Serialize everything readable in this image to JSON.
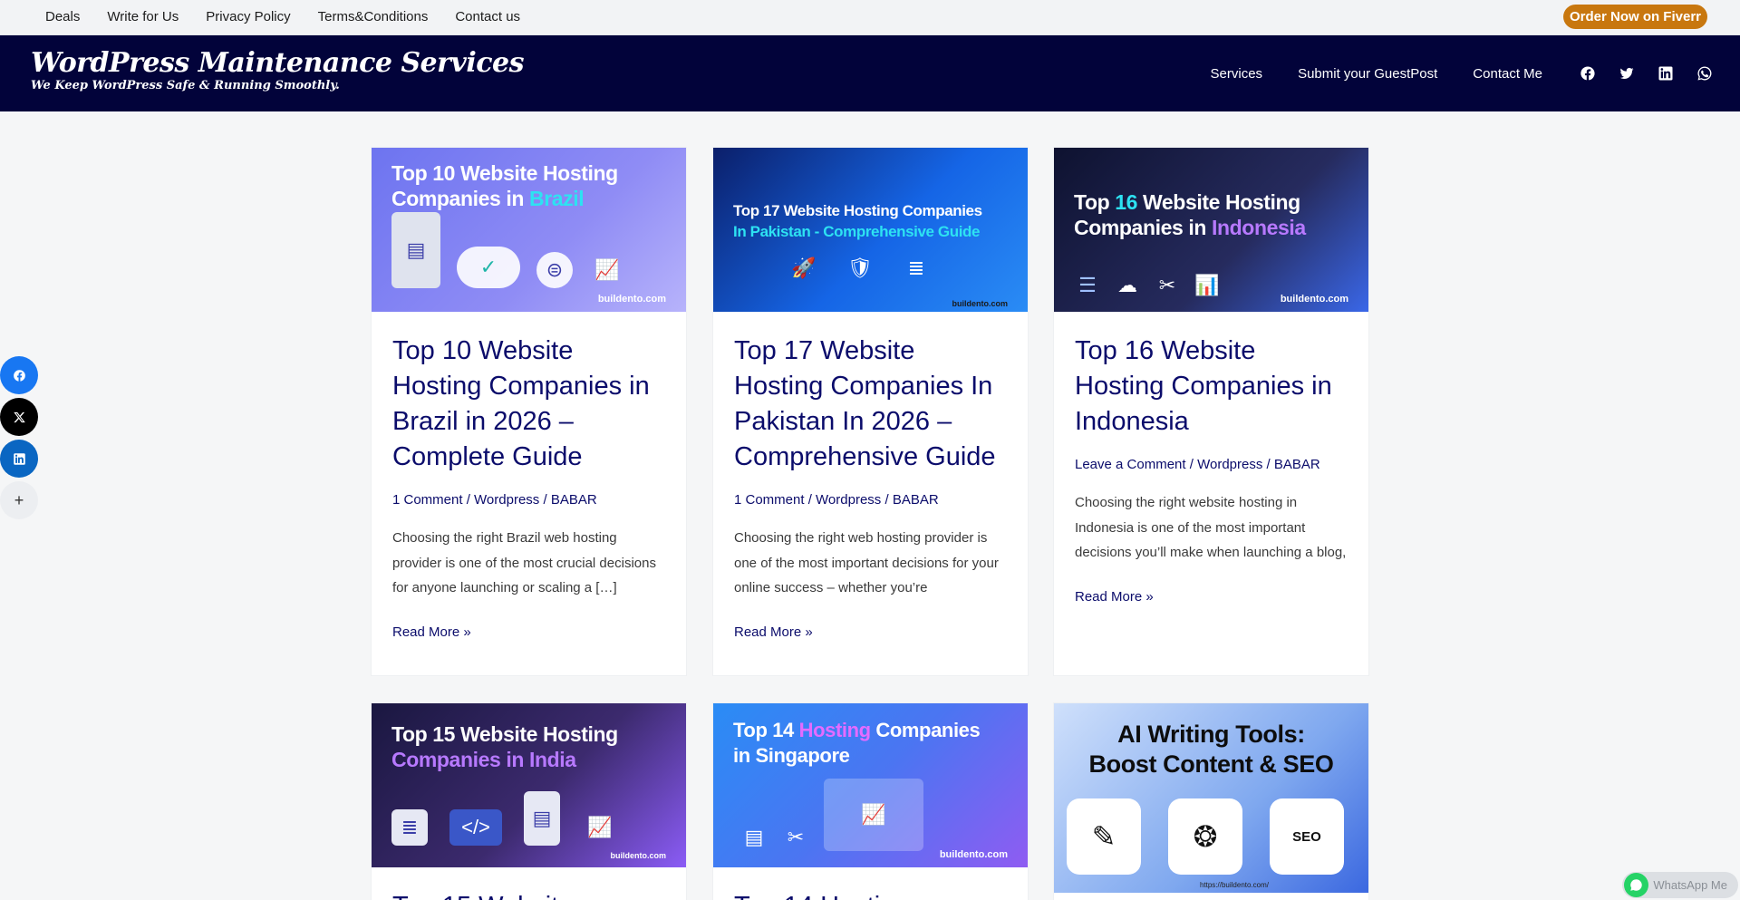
{
  "topbar": {
    "links": [
      "Deals",
      "Write for Us",
      "Privacy Policy",
      "Terms&Conditions",
      "Contact us"
    ],
    "cta": "Order Now on Fiverr"
  },
  "header": {
    "logo_title": "WordPress Maintenance Services",
    "logo_tagline": "We Keep WordPress Safe & Running Smoothly.",
    "nav": [
      "Services",
      "Submit your GuestPost",
      "Contact Me"
    ],
    "social_icons": [
      "facebook-icon",
      "twitter-icon",
      "linkedin-icon",
      "whatsapp-icon"
    ]
  },
  "share_sidebar": {
    "buttons": [
      "facebook-icon",
      "x-icon",
      "linkedin-icon",
      "plus-icon"
    ],
    "more_label": "+"
  },
  "posts": [
    {
      "thumb_line1": "Top 10 Website Hosting",
      "thumb_line2_pre": "Companies in ",
      "thumb_line2_accent": "Brazil",
      "thumb_url": "buildento.com",
      "title": "Top 10 Website Hosting Companies in Brazil in 2026 – Complete Guide",
      "comments": "1 Comment",
      "category": "Wordpress",
      "author": "BABAR",
      "excerpt": "Choosing the right Brazil web hosting provider is one of the most crucial decisions for anyone launching or scaling a […]",
      "read_more": "Read More »"
    },
    {
      "thumb_line1": "Top 17 Website Hosting Companies",
      "thumb_line2_pre": "",
      "thumb_line2_accent": "In Pakistan - Comprehensive Guide",
      "thumb_url": "buildento.com",
      "title": "Top 17 Website Hosting Companies In Pakistan In 2026 – Comprehensive Guide",
      "comments": "1 Comment",
      "category": "Wordpress",
      "author": "BABAR",
      "excerpt": "Choosing the right web hosting provider is one of the most important decisions for your online success – whether you’re",
      "read_more": "Read More »"
    },
    {
      "thumb_line1_pre": "Top ",
      "thumb_line1_accent": "16",
      "thumb_line1_post": " Website Hosting",
      "thumb_line2_pre": "Companies in ",
      "thumb_line2_accent": "Indonesia",
      "thumb_url": "buildento.com",
      "title": "Top 16 Website Hosting Companies in Indonesia",
      "comments": "Leave a Comment",
      "category": "Wordpress",
      "author": "BABAR",
      "excerpt": "Choosing the right website hosting in Indonesia is one of the most important decisions you’ll make when launching a blog,",
      "read_more": "Read More »"
    },
    {
      "thumb_line1": "Top 15 Website Hosting",
      "thumb_line2_accent": "Companies in India",
      "thumb_url": "buildento.com",
      "title_partial": "Top 15 Websit"
    },
    {
      "thumb_line1_pre": "Top 14 ",
      "thumb_line1_accent": "Hosting",
      "thumb_line1_post": " Companies",
      "thumb_line2": "in Singapore",
      "thumb_url": "buildento.com",
      "title_partial": "Top 14 Hosti"
    },
    {
      "thumb_line1": "AI Writing Tools:",
      "thumb_line2": "Boost Content & SEO",
      "thumb_url": "https://buildento.com/",
      "seo_label": "SEO"
    }
  ],
  "whatsapp": {
    "label": "WhatsApp Me"
  },
  "colors": {
    "header_bg": "#02033a",
    "cta_bg": "#c8770f",
    "link": "#0b0c6b",
    "facebook": "#1877f2",
    "linkedin": "#0a66c2",
    "whatsapp": "#25d366"
  }
}
